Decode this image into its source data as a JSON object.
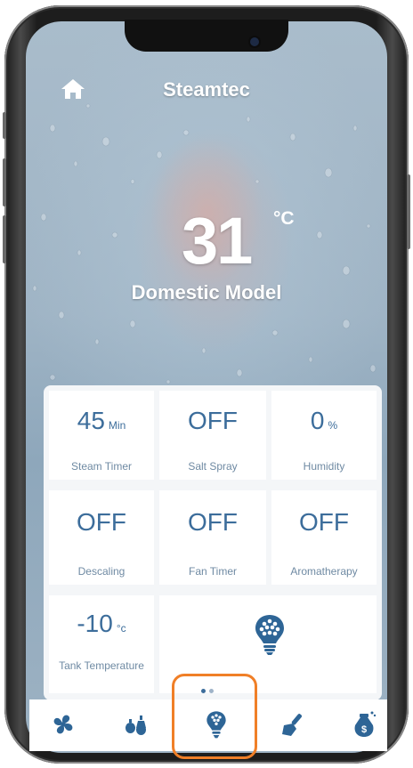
{
  "header": {
    "title": "Steamtec",
    "home_icon": "home-icon"
  },
  "status": {
    "temperature": "31",
    "unit": "°C",
    "model": "Domestic Model"
  },
  "tiles": [
    {
      "value": "45",
      "unit": "Min",
      "label": "Steam Timer"
    },
    {
      "value": "OFF",
      "unit": "",
      "label": "Salt Spray"
    },
    {
      "value": "0",
      "unit": "%",
      "label": "Humidity"
    },
    {
      "value": "OFF",
      "unit": "",
      "label": "Descaling"
    },
    {
      "value": "OFF",
      "unit": "",
      "label": "Fan Timer"
    },
    {
      "value": "OFF",
      "unit": "",
      "label": "Aromatherapy"
    },
    {
      "value": "-10",
      "unit": "°c",
      "label": "Tank Temperature"
    }
  ],
  "feature_icon": "light-bulb-icon",
  "nav": {
    "items": [
      "fan-icon",
      "aroma-drops-icon",
      "light-bulb-icon",
      "cleaning-brush-icon",
      "salt-bag-icon"
    ],
    "active_index": 2,
    "page_dots": 2,
    "active_dot": 0
  },
  "colors": {
    "accent": "#3c6d9b",
    "label": "#6f8aa3",
    "highlight": "#f07f27"
  }
}
